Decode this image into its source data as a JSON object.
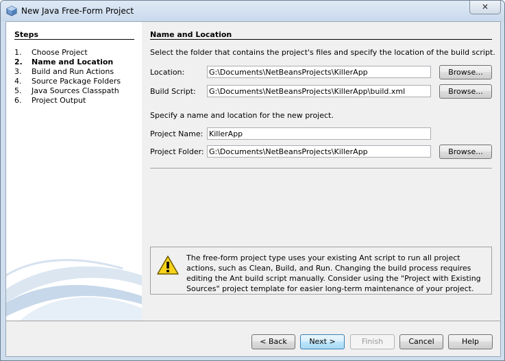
{
  "window": {
    "title": "New Java Free-Form Project",
    "close_label": "✕"
  },
  "steps": {
    "heading": "Steps",
    "items": [
      {
        "num": "1.",
        "label": "Choose Project"
      },
      {
        "num": "2.",
        "label": "Name and Location"
      },
      {
        "num": "3.",
        "label": "Build and Run Actions"
      },
      {
        "num": "4.",
        "label": "Source Package Folders"
      },
      {
        "num": "5.",
        "label": "Java Sources Classpath"
      },
      {
        "num": "6.",
        "label": "Project Output"
      }
    ]
  },
  "main": {
    "heading": "Name and Location",
    "intro": "Select the folder that contains the project's files and specify the location of the build script.",
    "location_label": "Location:",
    "location_value": "G:\\Documents\\NetBeansProjects\\KillerApp",
    "build_script_label": "Build Script:",
    "build_script_value": "G:\\Documents\\NetBeansProjects\\KillerApp\\build.xml",
    "browse_label": "Browse...",
    "specify_text": "Specify a name and location for the new project.",
    "project_name_label": "Project Name:",
    "project_name_value": "KillerApp",
    "project_folder_label": "Project Folder:",
    "project_folder_value": "G:\\Documents\\NetBeansProjects\\KillerApp",
    "warning_text": "The free-form project type uses your existing Ant script to run all project actions, such as Clean, Build, and Run. Changing the build process requires editing the Ant build script manually. Consider using the \"Project with Existing Sources\" project template for easier long-term maintenance of your  project."
  },
  "buttons": {
    "back": "< Back",
    "next": "Next >",
    "finish": "Finish",
    "cancel": "Cancel",
    "help": "Help"
  },
  "icons": {
    "app": "netbeans-cube-icon",
    "warning": "warning-triangle-icon"
  }
}
